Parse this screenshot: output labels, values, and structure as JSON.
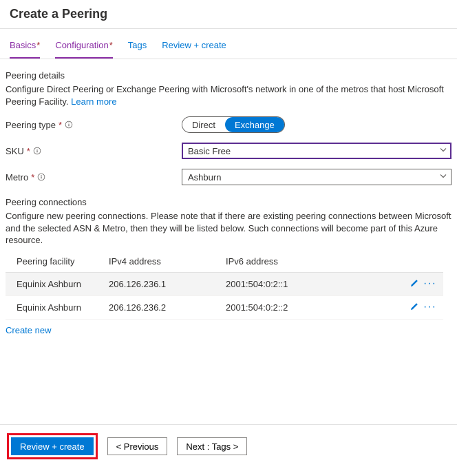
{
  "header": {
    "title": "Create a Peering"
  },
  "tabs": {
    "basics": "Basics",
    "configuration": "Configuration",
    "tags": "Tags",
    "review": "Review + create"
  },
  "details": {
    "heading": "Peering details",
    "desc_a": "Configure Direct Peering or Exchange Peering with Microsoft's network in one of the metros that host Microsoft Peering Facility. ",
    "learn_more": "Learn more"
  },
  "form": {
    "peering_type_label": "Peering type",
    "peering_type_options": {
      "direct": "Direct",
      "exchange": "Exchange"
    },
    "sku_label": "SKU",
    "sku_value": "Basic Free",
    "metro_label": "Metro",
    "metro_value": "Ashburn"
  },
  "connections": {
    "heading": "Peering connections",
    "desc": "Configure new peering connections. Please note that if there are existing peering connections between Microsoft and the selected ASN & Metro, then they will be listed below. Such connections will become part of this Azure resource.",
    "columns": {
      "facility": "Peering facility",
      "ipv4": "IPv4 address",
      "ipv6": "IPv6 address"
    },
    "rows": [
      {
        "facility": "Equinix Ashburn",
        "ipv4": "206.126.236.1",
        "ipv6": "2001:504:0:2::1"
      },
      {
        "facility": "Equinix Ashburn",
        "ipv4": "206.126.236.2",
        "ipv6": "2001:504:0:2::2"
      }
    ],
    "create_new": "Create new"
  },
  "footer": {
    "review_create": "Review + create",
    "previous": "< Previous",
    "next": "Next : Tags >"
  }
}
